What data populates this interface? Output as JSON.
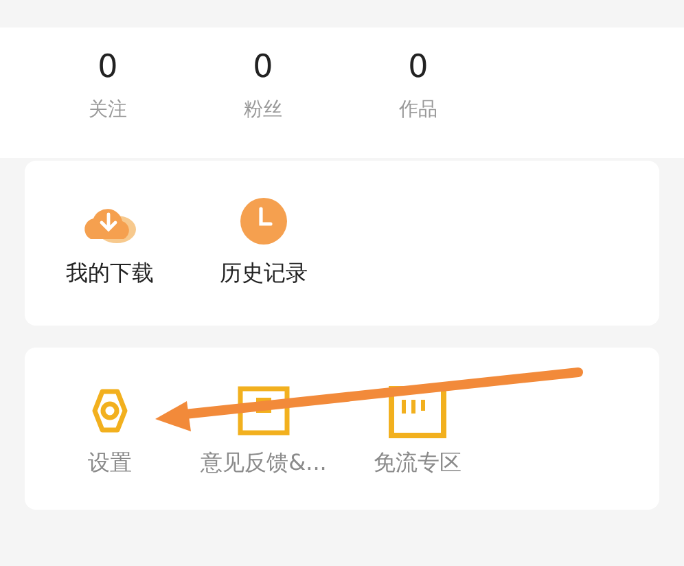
{
  "stats": [
    {
      "value": "0",
      "label": "关注"
    },
    {
      "value": "0",
      "label": "粉丝"
    },
    {
      "value": "0",
      "label": "作品"
    }
  ],
  "sections": [
    {
      "kind": "primary",
      "items": [
        {
          "label": "我的下载",
          "kind": "download"
        },
        {
          "label": "历史记录",
          "kind": "clock"
        }
      ]
    },
    {
      "kind": "secondary",
      "items": [
        {
          "label": "设置",
          "kind": "settings"
        },
        {
          "label": "意见反馈&...",
          "kind": "feedback"
        },
        {
          "label": "免流专区",
          "kind": "chart"
        }
      ]
    }
  ]
}
